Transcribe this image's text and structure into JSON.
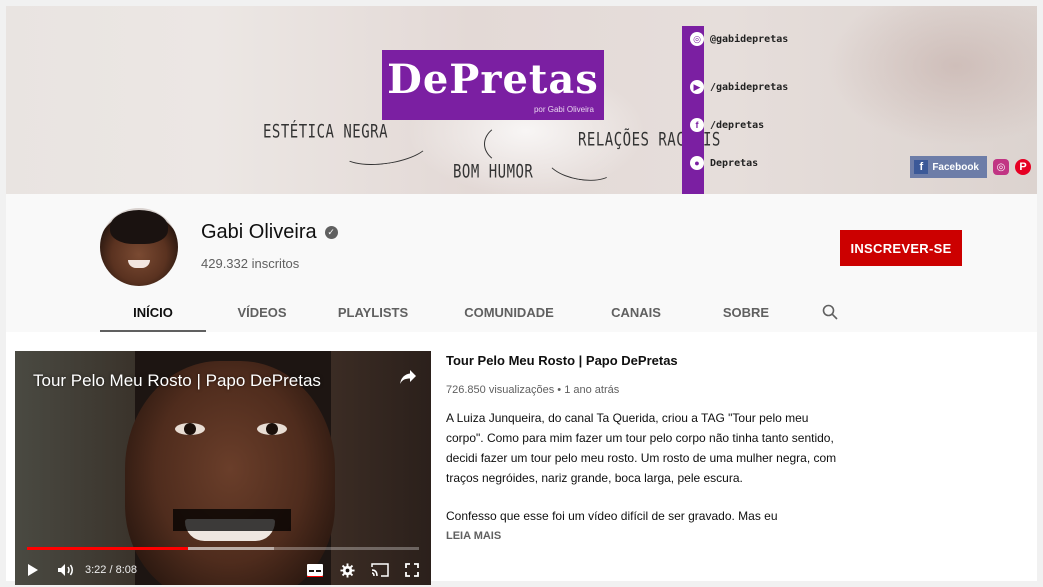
{
  "banner": {
    "logo_text": "DePretas",
    "logo_sub": "por Gabi Oliveira",
    "tags": [
      "ESTÉTICA NEGRA",
      "BOM HUMOR",
      "RELAÇÕES RACIAIS"
    ],
    "socials": [
      {
        "icon": "instagram-icon",
        "label": "@gabidepretas"
      },
      {
        "icon": "youtube-icon",
        "label": "/gabidepretas"
      },
      {
        "icon": "facebook-icon",
        "label": "/depretas"
      },
      {
        "icon": "snapchat-icon",
        "label": "Depretas"
      }
    ],
    "links": {
      "facebook_label": "Facebook"
    }
  },
  "channel": {
    "name": "Gabi Oliveira",
    "subscribers": "429.332 inscritos",
    "subscribe_label": "INSCREVER-SE"
  },
  "tabs": [
    {
      "label": "INÍCIO",
      "active": true
    },
    {
      "label": "VÍDEOS",
      "active": false
    },
    {
      "label": "PLAYLISTS",
      "active": false
    },
    {
      "label": "COMUNIDADE",
      "active": false
    },
    {
      "label": "CANAIS",
      "active": false
    },
    {
      "label": "SOBRE",
      "active": false
    }
  ],
  "featured": {
    "overlay_title": "Tour Pelo Meu Rosto | Papo DePretas",
    "title": "Tour Pelo Meu Rosto | Papo DePretas",
    "meta": "726.850 visualizações • 1 ano atrás",
    "desc_1": "A Luiza Junqueira, do canal Ta Querida, criou a TAG \"Tour pelo meu corpo\". Como para mim fazer um tour pelo corpo não tinha tanto sentido, decidi fazer um tour pelo meu rosto. Um rosto de uma mulher negra, com traços negróides, nariz grande, boca larga, pele escura.",
    "desc_2": "Confesso que esse foi um vídeo difícil de ser gravado. Mas eu",
    "read_more": "LEIA MAIS",
    "time": "3:22 / 8:08",
    "progress_fraction": 0.41,
    "buffer_fraction": 0.63
  },
  "colors": {
    "accent": "#cc0000",
    "brand_purple": "#7b1fa2",
    "progress": "#ff0000"
  }
}
